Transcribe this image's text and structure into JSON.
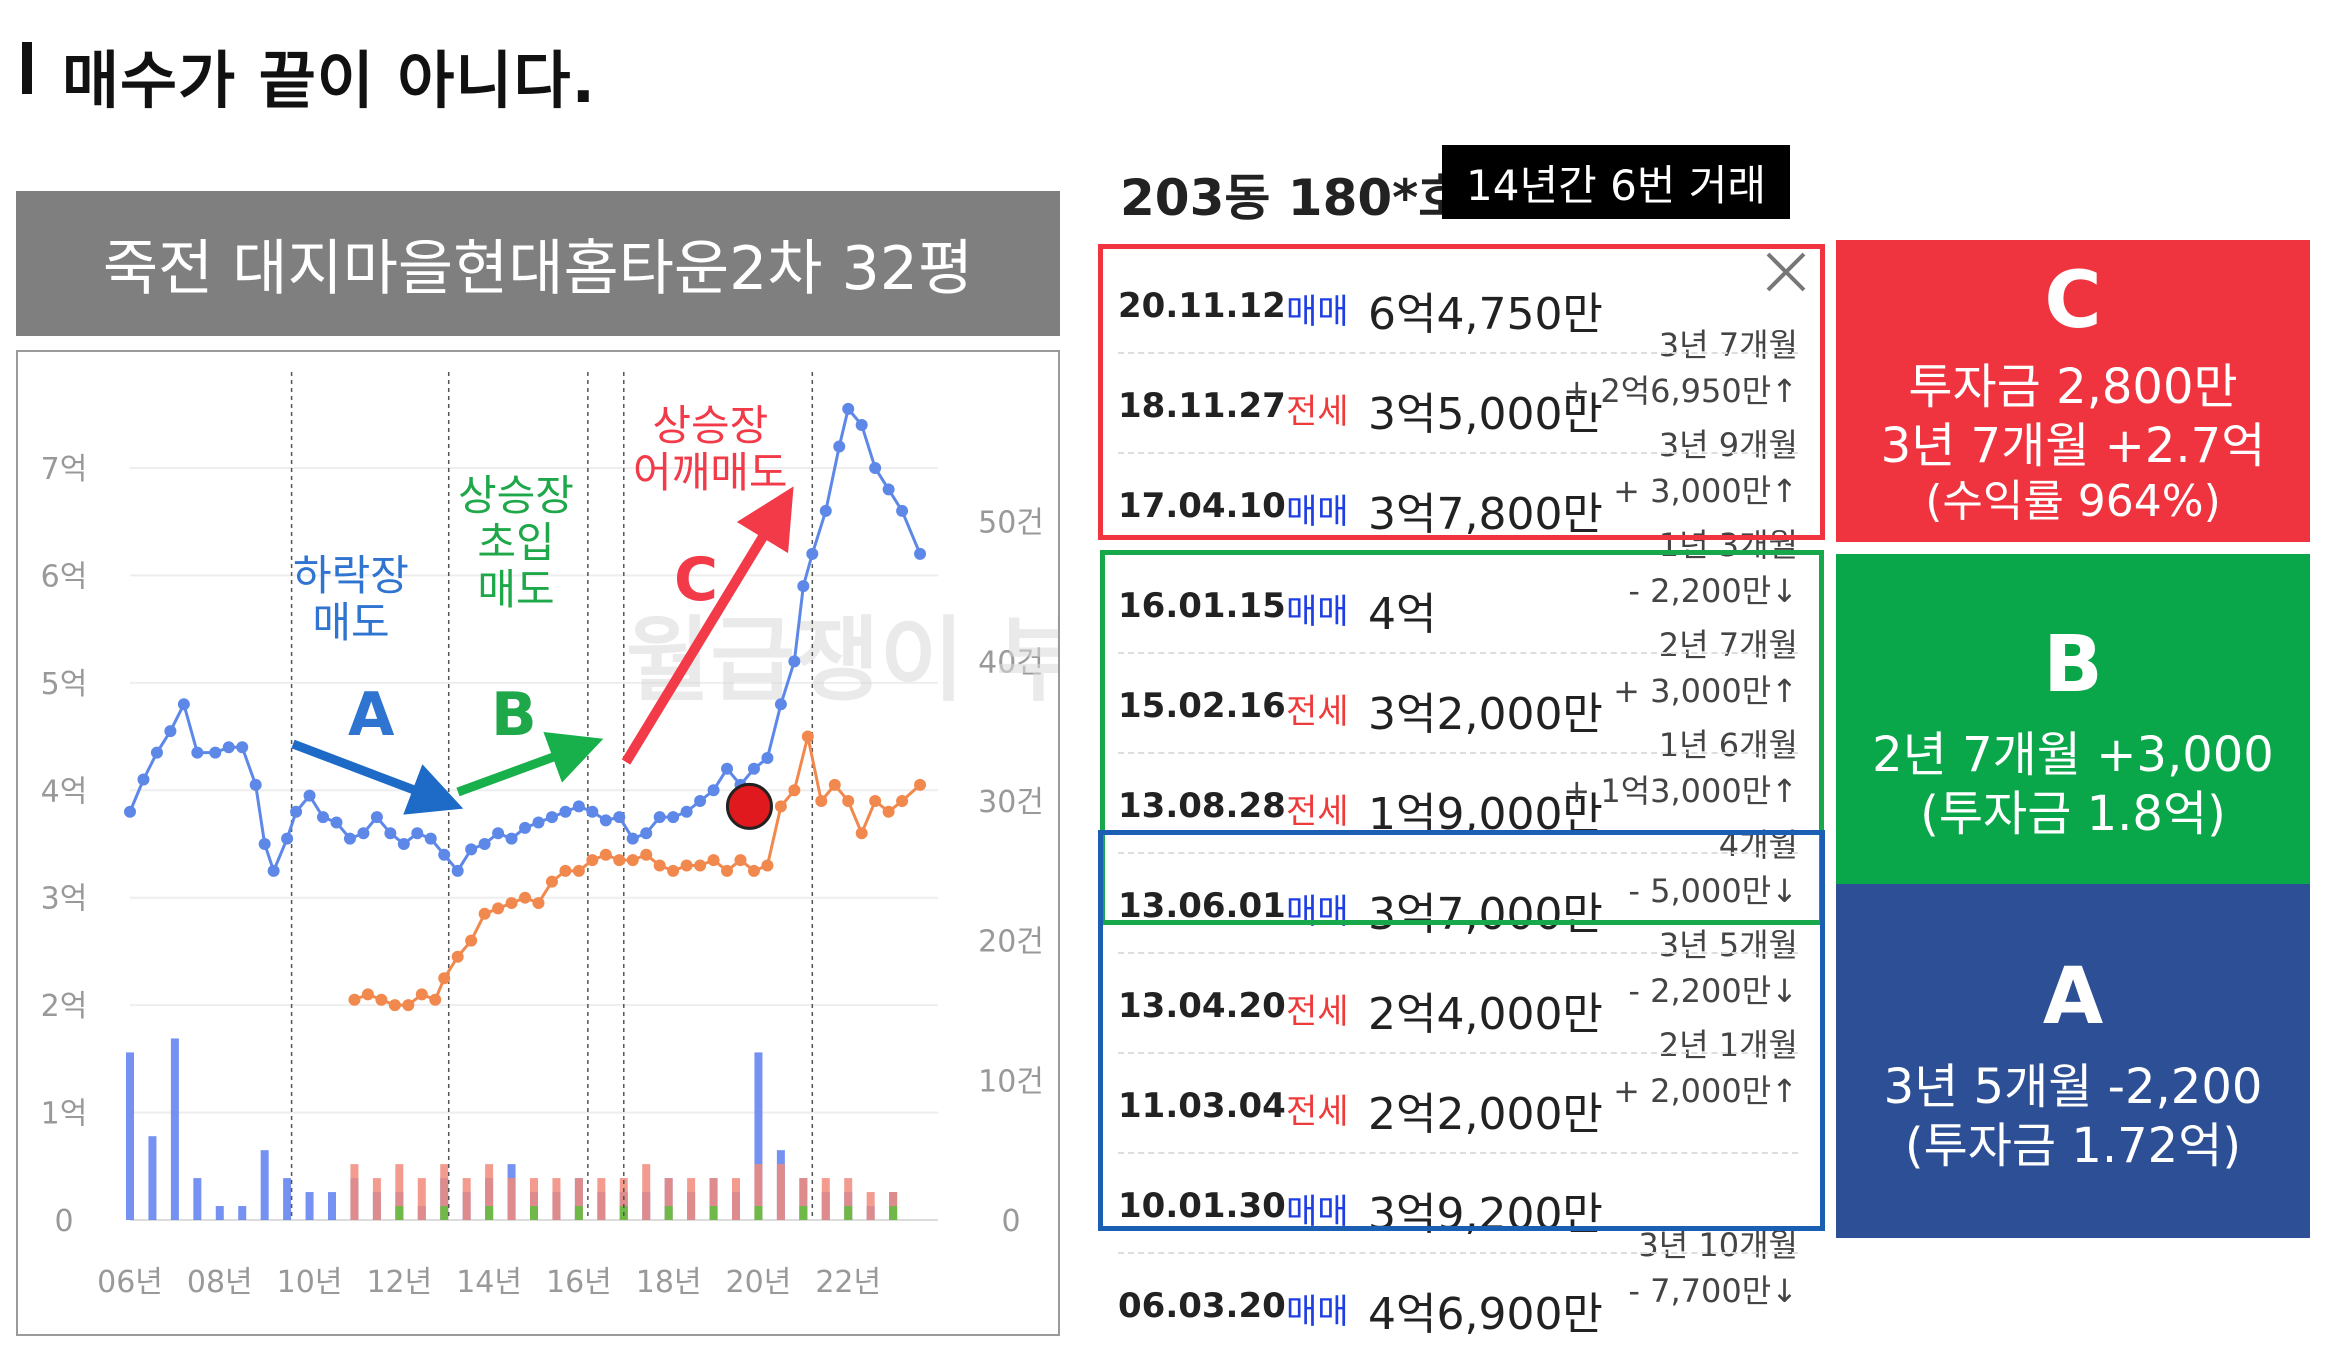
{
  "page": {
    "title": "매수가 끝이 아니다."
  },
  "chart_banner": "죽전 대지마을현대홈타운2차 32평",
  "chart_data": {
    "type": "line",
    "x_ticks": [
      "06년",
      "08년",
      "10년",
      "12년",
      "14년",
      "16년",
      "18년",
      "20년",
      "22년"
    ],
    "y_left_ticks": [
      "0",
      "1억",
      "2억",
      "3억",
      "4억",
      "5억",
      "6억",
      "7억"
    ],
    "y_right_ticks": [
      "0",
      "10건",
      "20건",
      "30건",
      "40건",
      "50건"
    ],
    "y_left_range": [
      0,
      7.8
    ],
    "y_right_range": [
      0,
      60
    ],
    "x_range": [
      2006,
      2024
    ],
    "grid": "horizontal",
    "phase_dividers": [
      2009.6,
      2013.1,
      2016.2,
      2017.0,
      2021.2
    ],
    "series": [
      {
        "color": "#5d88e8",
        "axis": "left",
        "points": [
          [
            2006.0,
            3.8
          ],
          [
            2006.3,
            4.1
          ],
          [
            2006.6,
            4.35
          ],
          [
            2006.9,
            4.55
          ],
          [
            2007.2,
            4.8
          ],
          [
            2007.5,
            4.35
          ],
          [
            2007.9,
            4.35
          ],
          [
            2008.2,
            4.4
          ],
          [
            2008.5,
            4.4
          ],
          [
            2008.8,
            4.05
          ],
          [
            2009.0,
            3.5
          ],
          [
            2009.2,
            3.25
          ],
          [
            2009.5,
            3.55
          ],
          [
            2009.7,
            3.8
          ],
          [
            2010.0,
            3.95
          ],
          [
            2010.3,
            3.75
          ],
          [
            2010.6,
            3.7
          ],
          [
            2010.9,
            3.55
          ],
          [
            2011.2,
            3.6
          ],
          [
            2011.5,
            3.75
          ],
          [
            2011.8,
            3.6
          ],
          [
            2012.1,
            3.5
          ],
          [
            2012.4,
            3.6
          ],
          [
            2012.7,
            3.55
          ],
          [
            2013.0,
            3.4
          ],
          [
            2013.3,
            3.25
          ],
          [
            2013.6,
            3.45
          ],
          [
            2013.9,
            3.5
          ],
          [
            2014.2,
            3.6
          ],
          [
            2014.5,
            3.55
          ],
          [
            2014.8,
            3.65
          ],
          [
            2015.1,
            3.7
          ],
          [
            2015.4,
            3.75
          ],
          [
            2015.7,
            3.8
          ],
          [
            2016.0,
            3.85
          ],
          [
            2016.3,
            3.8
          ],
          [
            2016.6,
            3.72
          ],
          [
            2016.9,
            3.75
          ],
          [
            2017.2,
            3.55
          ],
          [
            2017.5,
            3.6
          ],
          [
            2017.8,
            3.75
          ],
          [
            2018.1,
            3.75
          ],
          [
            2018.4,
            3.8
          ],
          [
            2018.7,
            3.9
          ],
          [
            2019.0,
            4.0
          ],
          [
            2019.3,
            4.2
          ],
          [
            2019.6,
            4.05
          ],
          [
            2019.9,
            4.2
          ],
          [
            2020.2,
            4.3
          ],
          [
            2020.5,
            4.8
          ],
          [
            2020.8,
            5.2
          ],
          [
            2021.0,
            5.9
          ],
          [
            2021.2,
            6.2
          ],
          [
            2021.5,
            6.6
          ],
          [
            2021.8,
            7.2
          ],
          [
            2022.0,
            7.55
          ],
          [
            2022.3,
            7.4
          ],
          [
            2022.6,
            7.0
          ],
          [
            2022.9,
            6.8
          ],
          [
            2023.2,
            6.6
          ],
          [
            2023.6,
            6.2
          ]
        ]
      },
      {
        "color": "#f1894e",
        "axis": "left",
        "points": [
          [
            2011.0,
            2.05
          ],
          [
            2011.3,
            2.1
          ],
          [
            2011.6,
            2.05
          ],
          [
            2011.9,
            2.0
          ],
          [
            2012.2,
            2.0
          ],
          [
            2012.5,
            2.1
          ],
          [
            2012.8,
            2.05
          ],
          [
            2013.0,
            2.25
          ],
          [
            2013.3,
            2.45
          ],
          [
            2013.6,
            2.6
          ],
          [
            2013.9,
            2.85
          ],
          [
            2014.2,
            2.9
          ],
          [
            2014.5,
            2.95
          ],
          [
            2014.8,
            3.0
          ],
          [
            2015.1,
            2.95
          ],
          [
            2015.4,
            3.15
          ],
          [
            2015.7,
            3.25
          ],
          [
            2016.0,
            3.25
          ],
          [
            2016.3,
            3.35
          ],
          [
            2016.6,
            3.4
          ],
          [
            2016.9,
            3.35
          ],
          [
            2017.2,
            3.35
          ],
          [
            2017.5,
            3.4
          ],
          [
            2017.8,
            3.3
          ],
          [
            2018.1,
            3.25
          ],
          [
            2018.4,
            3.3
          ],
          [
            2018.7,
            3.3
          ],
          [
            2019.0,
            3.35
          ],
          [
            2019.3,
            3.25
          ],
          [
            2019.6,
            3.35
          ],
          [
            2019.9,
            3.25
          ],
          [
            2020.2,
            3.3
          ],
          [
            2020.5,
            3.85
          ],
          [
            2020.8,
            4.0
          ],
          [
            2021.1,
            4.5
          ],
          [
            2021.4,
            3.9
          ],
          [
            2021.7,
            4.05
          ],
          [
            2022.0,
            3.9
          ],
          [
            2022.3,
            3.6
          ],
          [
            2022.6,
            3.9
          ],
          [
            2022.9,
            3.8
          ],
          [
            2023.2,
            3.9
          ],
          [
            2023.6,
            4.05
          ]
        ]
      }
    ],
    "volume_series": [
      {
        "color": "#5d7ff0",
        "values": [
          [
            2006,
            12
          ],
          [
            2006.5,
            6
          ],
          [
            2007,
            13
          ],
          [
            2007.5,
            3
          ],
          [
            2008,
            1
          ],
          [
            2008.5,
            1
          ],
          [
            2009,
            5
          ],
          [
            2009.5,
            3
          ],
          [
            2010,
            2
          ],
          [
            2010.5,
            2
          ],
          [
            2011,
            3
          ],
          [
            2011.5,
            2
          ],
          [
            2012,
            2
          ],
          [
            2012.5,
            1
          ],
          [
            2013,
            3
          ],
          [
            2013.5,
            2
          ],
          [
            2014,
            3
          ],
          [
            2014.5,
            4
          ],
          [
            2015,
            2
          ],
          [
            2015.5,
            2
          ],
          [
            2016,
            3
          ],
          [
            2016.5,
            2
          ],
          [
            2017,
            2
          ],
          [
            2017.5,
            2
          ],
          [
            2018,
            3
          ],
          [
            2018.5,
            2
          ],
          [
            2019,
            3
          ],
          [
            2019.5,
            2
          ],
          [
            2020,
            12
          ],
          [
            2020.5,
            5
          ],
          [
            2021,
            3
          ],
          [
            2021.5,
            2
          ],
          [
            2022,
            2
          ],
          [
            2022.5,
            1
          ],
          [
            2023,
            2
          ]
        ]
      },
      {
        "color": "#f08a7a",
        "values": [
          [
            2011,
            4
          ],
          [
            2011.5,
            3
          ],
          [
            2012,
            4
          ],
          [
            2012.5,
            3
          ],
          [
            2013,
            4
          ],
          [
            2013.5,
            3
          ],
          [
            2014,
            4
          ],
          [
            2014.5,
            3
          ],
          [
            2015,
            3
          ],
          [
            2015.5,
            3
          ],
          [
            2016,
            3
          ],
          [
            2016.5,
            3
          ],
          [
            2017,
            3
          ],
          [
            2017.5,
            4
          ],
          [
            2018,
            3
          ],
          [
            2018.5,
            3
          ],
          [
            2019,
            3
          ],
          [
            2019.5,
            3
          ],
          [
            2020,
            4
          ],
          [
            2020.5,
            4
          ],
          [
            2021,
            3
          ],
          [
            2021.5,
            3
          ],
          [
            2022,
            3
          ],
          [
            2022.5,
            2
          ],
          [
            2023,
            2
          ]
        ]
      },
      {
        "color": "#5dbf3c",
        "values": [
          [
            2012,
            1
          ],
          [
            2013,
            1
          ],
          [
            2014,
            1
          ],
          [
            2015,
            1
          ],
          [
            2016,
            1
          ],
          [
            2017,
            1
          ],
          [
            2018,
            1
          ],
          [
            2019,
            1
          ],
          [
            2020,
            1
          ],
          [
            2021,
            1
          ],
          [
            2022,
            1
          ],
          [
            2023,
            1
          ]
        ]
      }
    ],
    "marker": {
      "x": 2019.8,
      "y": 3.85,
      "color": "#e0191f"
    },
    "watermark": "월급쟁이 부자들"
  },
  "annotations": {
    "a_label": "하락장\n매도",
    "a_letter": "A",
    "b_label": "상승장\n초입\n매도",
    "b_letter": "B",
    "c_label": "상승장\n어깨매도",
    "c_letter": "C"
  },
  "table": {
    "unit": "203동 180*호",
    "badge": "14년간 6번 거래",
    "rows": [
      {
        "date": "20.11.12",
        "type": "매매",
        "kind": "sale",
        "price": "6억4,750만",
        "gap1": "",
        "gap2": ""
      },
      {
        "date": "18.11.27",
        "type": "전세",
        "kind": "lease",
        "price": "3억5,000만",
        "gap1": "3년 7개월",
        "gap2": "+ 2억6,950만↑"
      },
      {
        "date": "17.04.10",
        "type": "매매",
        "kind": "sale",
        "price": "3억7,800만",
        "gap1": "3년 9개월",
        "gap2": "+ 3,000만↑"
      },
      {
        "date": "16.01.15",
        "type": "매매",
        "kind": "sale",
        "price": "4억",
        "gap1": "1년 3개월",
        "gap2": "- 2,200만↓"
      },
      {
        "date": "15.02.16",
        "type": "전세",
        "kind": "lease",
        "price": "3억2,000만",
        "gap1": "2년 7개월",
        "gap2": "+ 3,000만↑"
      },
      {
        "date": "13.08.28",
        "type": "전세",
        "kind": "lease",
        "price": "1억9,000만",
        "gap1": "1년 6개월",
        "gap2": "+ 1억3,000만↑"
      },
      {
        "date": "13.06.01",
        "type": "매매",
        "kind": "sale",
        "price": "3억7,000만",
        "gap1": "4개월",
        "gap2": "- 5,000만↓"
      },
      {
        "date": "13.04.20",
        "type": "전세",
        "kind": "lease",
        "price": "2억4,000만",
        "gap1": "3년 5개월",
        "gap2": "- 2,200만↓"
      },
      {
        "date": "11.03.04",
        "type": "전세",
        "kind": "lease",
        "price": "2억2,000만",
        "gap1": "2년 1개월",
        "gap2": "+ 2,000만↑"
      },
      {
        "date": "10.01.30",
        "type": "매매",
        "kind": "sale",
        "price": "3억9,200만",
        "gap1": "",
        "gap2": ""
      },
      {
        "date": "06.03.20",
        "type": "매매",
        "kind": "sale",
        "price": "4억6,900만",
        "gap1": "3년 10개월",
        "gap2": "- 7,700만↓"
      }
    ]
  },
  "results": {
    "c": {
      "letter": "C",
      "line1": "투자금 2,800만",
      "line2": "3년 7개월 +2.7억",
      "line3": "(수익률 964%)",
      "color": "#f0343f"
    },
    "b": {
      "letter": "B",
      "line1": "2년 7개월 +3,000",
      "line2": "(투자금 1.8억)",
      "color": "#0aa64a"
    },
    "a": {
      "letter": "A",
      "line1": "3년 5개월 -2,200",
      "line2": "(투자금 1.72억)",
      "color": "#2c4f95"
    }
  }
}
